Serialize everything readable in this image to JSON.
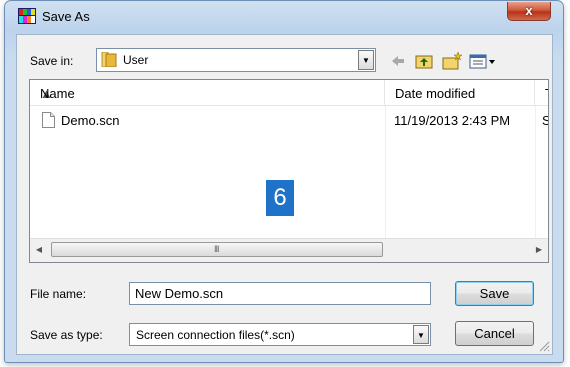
{
  "window": {
    "title": "Save As",
    "close_label": "x"
  },
  "toolbar": {
    "save_in_label": "Save in:",
    "save_in_value": "User",
    "icons": [
      "back-arrow-icon",
      "up-folder-icon",
      "new-folder-icon",
      "views-menu-icon"
    ]
  },
  "filelist": {
    "columns": [
      "Name",
      "Date modified",
      "Ty"
    ],
    "rows": [
      {
        "name": "Demo.scn",
        "date": "11/19/2013 2:43 PM",
        "type": "SC"
      }
    ],
    "step_marker": "6",
    "scroll_grip": "III"
  },
  "form": {
    "file_name_label": "File name:",
    "file_name_value": "New Demo.scn",
    "save_type_label": "Save as type:",
    "save_type_value": "Screen connection files(*.scn)"
  },
  "buttons": {
    "save": "Save",
    "cancel": "Cancel"
  }
}
